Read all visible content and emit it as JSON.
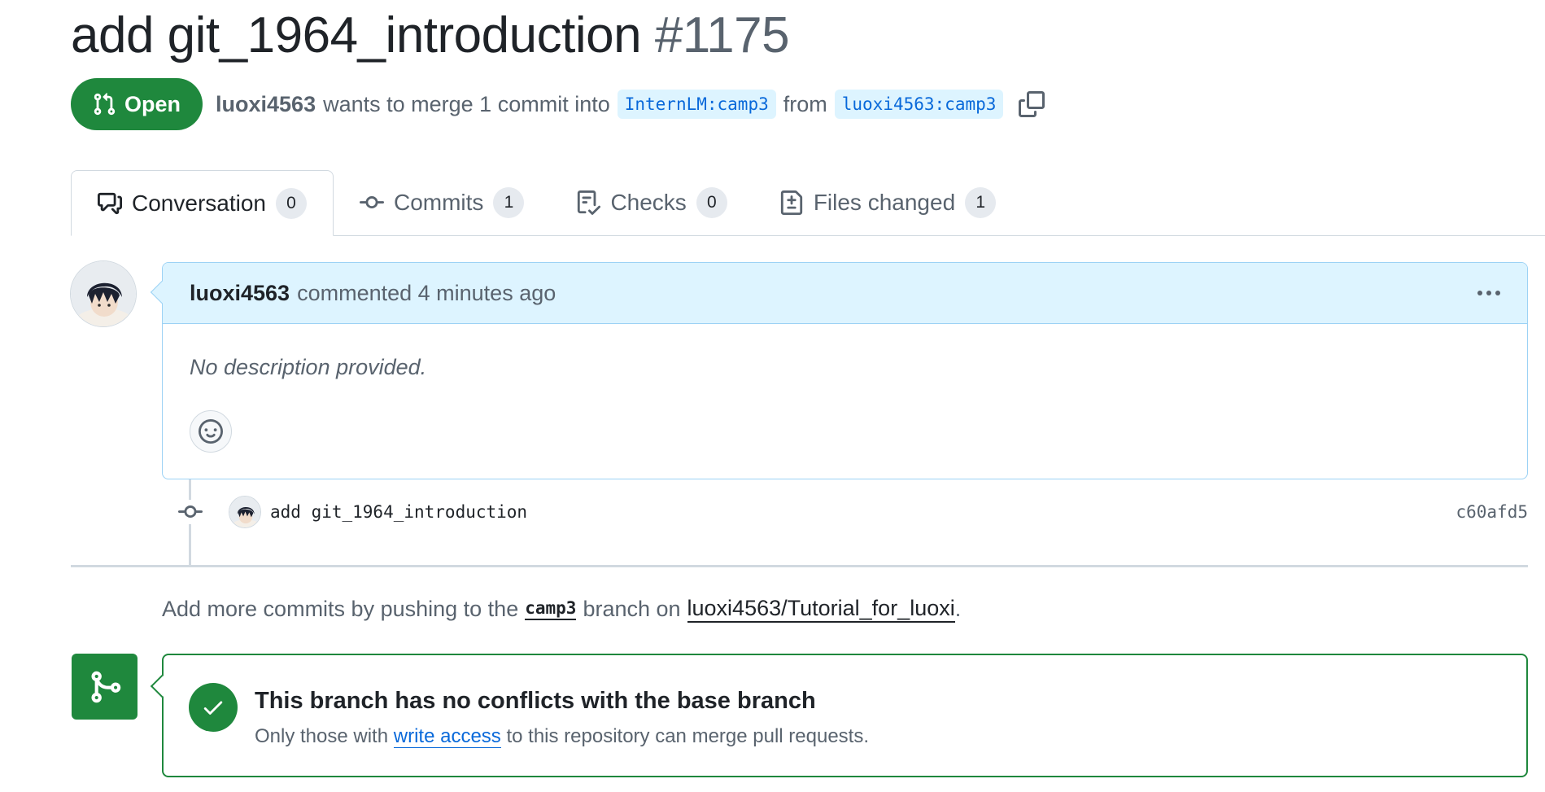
{
  "pr": {
    "title": "add git_1964_introduction",
    "number": "#1175",
    "state": "Open",
    "author": "luoxi4563",
    "merge_text": "wants to merge 1 commit into",
    "base_branch": "InternLM:camp3",
    "from_text": "from",
    "head_branch": "luoxi4563:camp3"
  },
  "tabs": [
    {
      "label": "Conversation",
      "count": "0",
      "icon": "comment-discussion-icon"
    },
    {
      "label": "Commits",
      "count": "1",
      "icon": "git-commit-icon"
    },
    {
      "label": "Checks",
      "count": "0",
      "icon": "checklist-icon"
    },
    {
      "label": "Files changed",
      "count": "1",
      "icon": "file-diff-icon"
    }
  ],
  "comment": {
    "author": "luoxi4563",
    "action": "commented 4 minutes ago",
    "body": "No description provided."
  },
  "commit": {
    "message": "add git_1964_introduction",
    "sha": "c60afd5"
  },
  "hint": {
    "prefix": "Add more commits by pushing to the",
    "branch": "camp3",
    "middle": "branch on",
    "repo": "luoxi4563/Tutorial_for_luoxi",
    "suffix": "."
  },
  "merge": {
    "title": "This branch has no conflicts with the base branch",
    "sub_prefix": "Only those with",
    "sub_link": "write access",
    "sub_suffix": "to this repository can merge pull requests."
  },
  "colors": {
    "accent_green": "#1f883d",
    "link_blue": "#0969da",
    "header_blue_bg": "#ddf4ff"
  }
}
